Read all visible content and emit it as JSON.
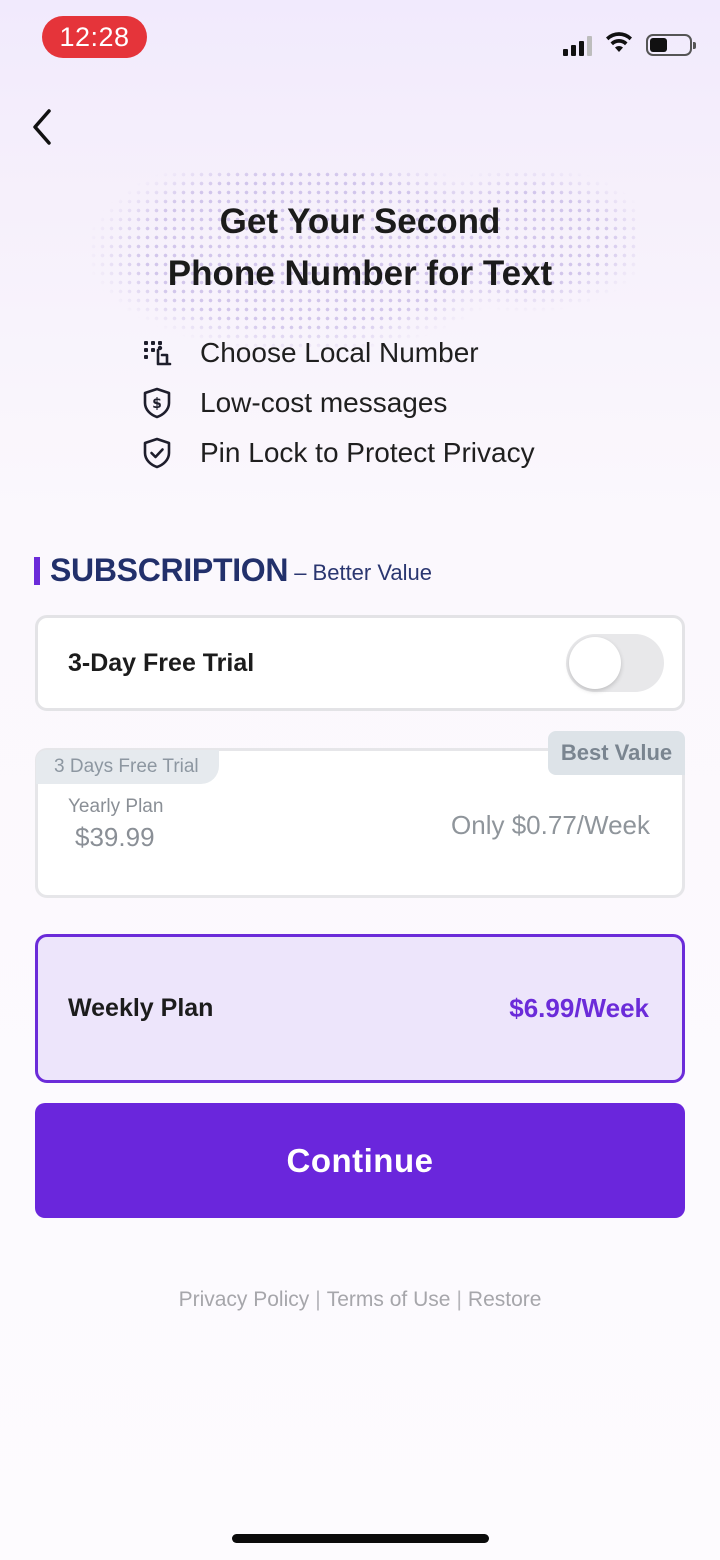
{
  "status_bar": {
    "time": "12:28",
    "time_pill_color": "#e5343a",
    "icons": [
      "signal-icon",
      "wifi-icon",
      "battery-icon"
    ],
    "battery_level": 0.45
  },
  "header": {
    "back_icon": "chevron-left-icon",
    "title_line1": "Get Your Second",
    "title_line2": "Phone Number for Text"
  },
  "features": [
    {
      "icon": "dial-pad-icon",
      "label": "Choose Local Number"
    },
    {
      "icon": "dollar-shield-icon",
      "label": "Low-cost messages"
    },
    {
      "icon": "shield-check-icon",
      "label": "Pin Lock to Protect Privacy"
    }
  ],
  "subscription": {
    "title": "SUBSCRIPTION",
    "subtitle": "– Better Value",
    "accent_color": "#6b2bd9"
  },
  "trial_toggle": {
    "label": "3-Day Free Trial",
    "enabled": false
  },
  "plans": {
    "yearly": {
      "tag": "3 Days Free Trial",
      "badge": "Best Value",
      "name": "Yearly Plan",
      "price": "$39.99",
      "per_week": "Only $0.77/Week",
      "selected": false
    },
    "weekly": {
      "name": "Weekly Plan",
      "price": "$6.99/Week",
      "selected": true
    }
  },
  "cta": {
    "label": "Continue",
    "color": "#6a26dc"
  },
  "footer": {
    "privacy": "Privacy Policy",
    "terms": "Terms of Use",
    "restore": "Restore",
    "separator": "|"
  }
}
